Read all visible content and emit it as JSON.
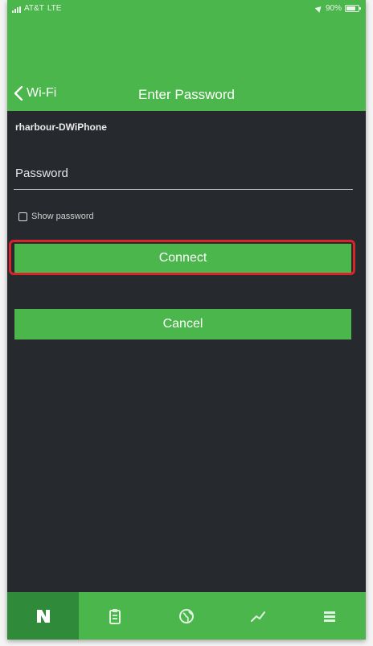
{
  "statusbar": {
    "carrier": "AT&T",
    "network": "LTE",
    "battery": "90%"
  },
  "navbar": {
    "back_label": "Wi-Fi",
    "title": "Enter Password"
  },
  "network_name": "rharbour-DWiPhone",
  "password": {
    "placeholder": "Password",
    "value": ""
  },
  "show_password": {
    "label": "Show password",
    "checked": false
  },
  "buttons": {
    "connect": "Connect",
    "cancel": "Cancel"
  },
  "tabs": [
    {
      "icon": "logo-icon",
      "active": true
    },
    {
      "icon": "clipboard-icon",
      "active": false
    },
    {
      "icon": "globe-icon",
      "active": false
    },
    {
      "icon": "chart-line-icon",
      "active": false
    },
    {
      "icon": "list-icon",
      "active": false
    }
  ],
  "colors": {
    "accent": "#4ab64b",
    "background": "#26292e",
    "active_tab": "#2f8a3a",
    "highlight": "#d8242a"
  }
}
